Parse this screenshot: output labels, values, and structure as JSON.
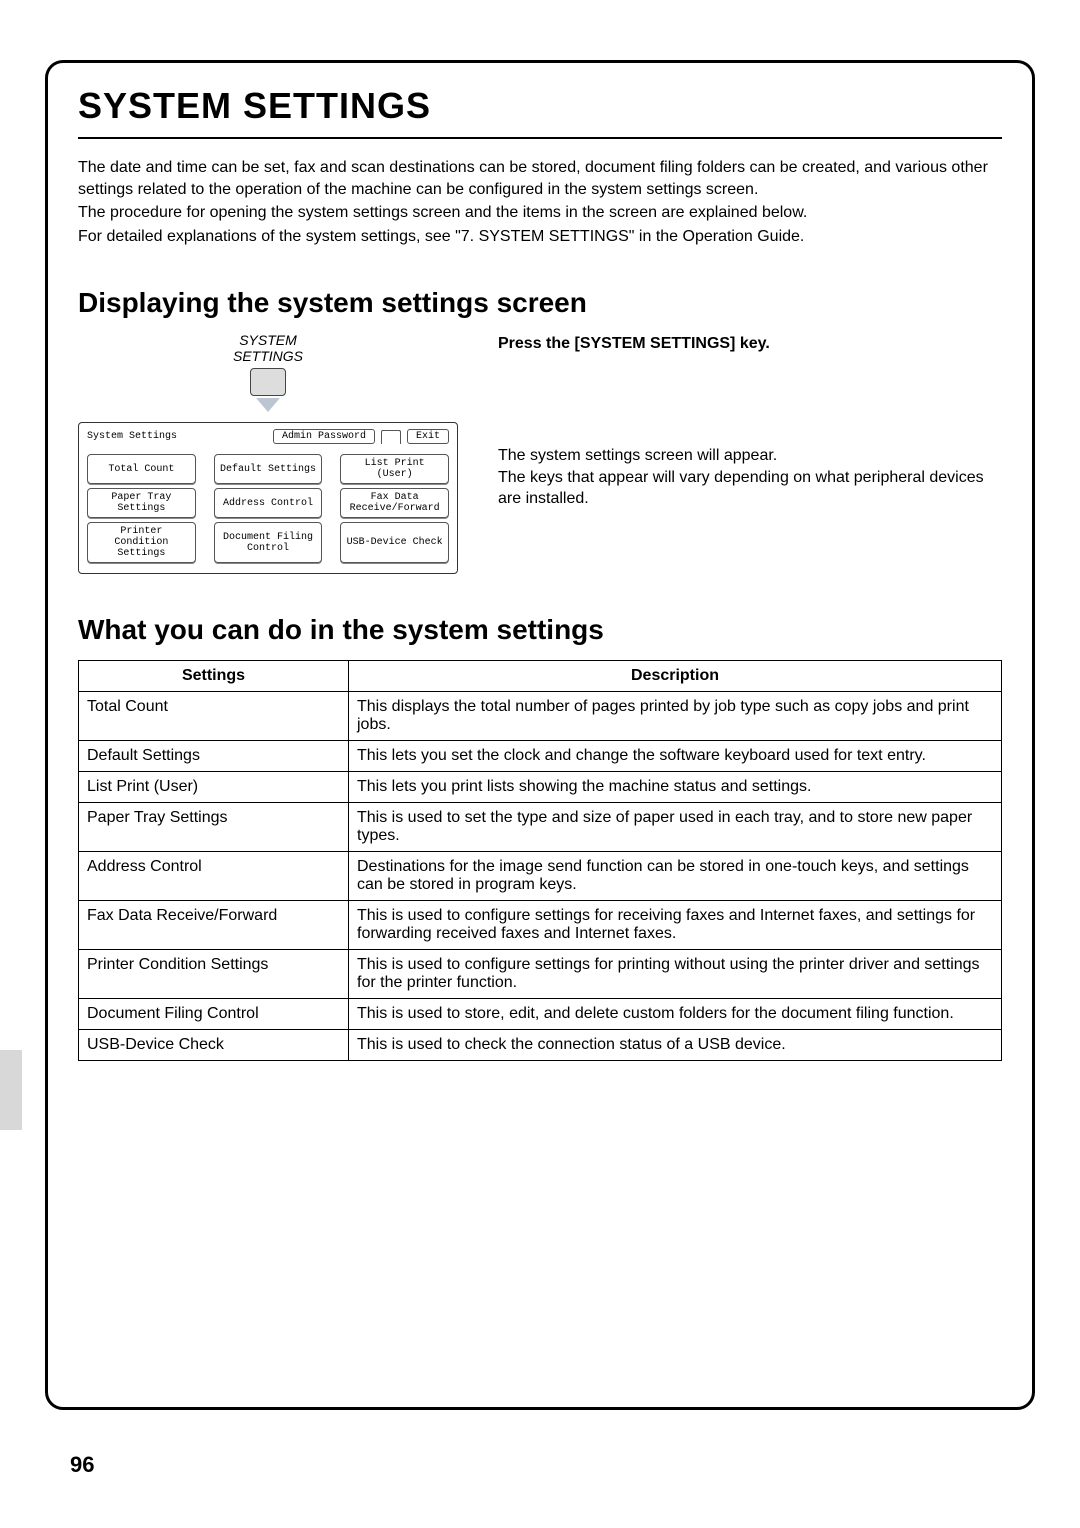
{
  "page": {
    "title": "SYSTEM SETTINGS",
    "intro_p1": "The date and time can be set, fax and scan destinations can be stored, document filing folders can be created, and various other settings related to the operation of the machine can be configured in the system settings screen.",
    "intro_p2": "The procedure for opening the system settings screen and the items in the screen are explained below.",
    "intro_p3": "For detailed explanations of the system settings, see \"7. SYSTEM SETTINGS\" in the Operation Guide.",
    "number": "96"
  },
  "section1": {
    "title": "Displaying the system settings screen",
    "key_caption_l1": "SYSTEM",
    "key_caption_l2": "SETTINGS",
    "instruction_title": "Press the [SYSTEM SETTINGS] key.",
    "instruction_body_l1": "The system settings screen will appear.",
    "instruction_body_l2": "The keys that appear will vary depending on what peripheral devices are installed."
  },
  "panel": {
    "title": "System Settings",
    "admin_btn": "Admin Password",
    "exit_btn": "Exit",
    "buttons": [
      "Total Count",
      "Default Settings",
      "List Print\n(User)",
      "Paper Tray\nSettings",
      "Address Control",
      "Fax Data\nReceive/Forward",
      "Printer Condition\nSettings",
      "Document Filing\nControl",
      "USB-Device Check"
    ]
  },
  "section2": {
    "title": "What you can do in the system settings",
    "col_settings": "Settings",
    "col_description": "Description",
    "rows": [
      {
        "s": "Total Count",
        "d": "This displays the total number of pages printed by job type such as copy jobs and print jobs."
      },
      {
        "s": "Default Settings",
        "d": "This lets you set the clock and change the software keyboard used for text entry."
      },
      {
        "s": "List Print (User)",
        "d": "This lets you print lists showing the machine status and settings."
      },
      {
        "s": "Paper Tray Settings",
        "d": "This is used to set the type and size of paper used in each tray, and to store new paper types."
      },
      {
        "s": "Address Control",
        "d": "Destinations for the image send function can be stored in one-touch keys, and settings can be stored in program keys."
      },
      {
        "s": "Fax Data Receive/Forward",
        "d": "This is used to configure settings for receiving faxes and Internet faxes, and settings for forwarding received faxes and Internet faxes."
      },
      {
        "s": "Printer Condition Settings",
        "d": "This is used to configure settings for printing without using the printer driver and settings for the printer function."
      },
      {
        "s": "Document Filing Control",
        "d": "This is used to store, edit, and delete custom folders for the document filing function."
      },
      {
        "s": "USB-Device Check",
        "d": "This is used to check the connection status of a USB device."
      }
    ]
  }
}
